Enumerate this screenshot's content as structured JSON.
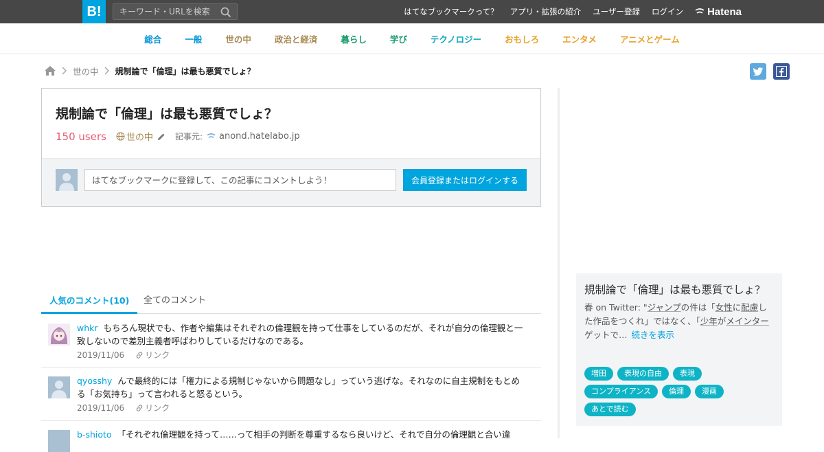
{
  "topbar": {
    "logo": "B!",
    "search_placeholder": "キーワード・URLを検索",
    "nav": [
      "はてなブックマークって？",
      "アプリ・拡張の紹介",
      "ユーザー登録",
      "ログイン"
    ],
    "brand": "Hatena"
  },
  "categories": [
    {
      "label": "総合",
      "color": "#0094d5"
    },
    {
      "label": "一般",
      "color": "#0094d5"
    },
    {
      "label": "世の中",
      "color": "#a88851"
    },
    {
      "label": "政治と経済",
      "color": "#a88851"
    },
    {
      "label": "暮らし",
      "color": "#1a9c6b"
    },
    {
      "label": "学び",
      "color": "#1a9c6b"
    },
    {
      "label": "テクノロジー",
      "color": "#14a5c4"
    },
    {
      "label": "おもしろ",
      "color": "#e8a12b"
    },
    {
      "label": "エンタメ",
      "color": "#e8a12b"
    },
    {
      "label": "アニメとゲーム",
      "color": "#e8a12b"
    }
  ],
  "breadcrumb": {
    "category": "世の中",
    "current": "規制論で「倫理」は最も悪質でしょ？"
  },
  "entry": {
    "title": "規制論で「倫理」は最も悪質でしょ？",
    "users": "150 users",
    "category": "世の中",
    "source_label": "記事元:",
    "source": "anond.hatelabo.jp",
    "comment_placeholder": "はてなブックマークに登録して、この記事にコメントしよう！",
    "login_button": "会員登録またはログインする"
  },
  "tabs": {
    "popular": "人気のコメント(10)",
    "all": "全てのコメント"
  },
  "comments": [
    {
      "user": "whkr",
      "text": "もちろん現状でも、作者や編集はそれぞれの倫理観を持って仕事をしているのだが、それが自分の倫理観と一致しないので差別主義者呼ばわりしているだけなのである。",
      "date": "2019/11/06",
      "link": "リンク"
    },
    {
      "user": "qyosshy",
      "text": "んで最終的には「権力による規制じゃないから問題なし」っていう逃げな。それなのに自主規制をもとめる「お気持ち」って言われると怒るという。",
      "date": "2019/11/06",
      "link": "リンク"
    },
    {
      "user": "b-shioto",
      "text": "「それぞれ倫理観を持って……って相手の判断を尊重するなら良いけど、それで自分の倫理観と合い違",
      "date": "",
      "link": ""
    }
  ],
  "sidebar": {
    "title": "規制論で「倫理」は最も悪質でしょ？",
    "text_prefix": "春 on Twitter: \"",
    "text_1": "ジャンプ",
    "text_2": "の件は「",
    "text_3": "女性",
    "text_4": "に",
    "text_5": "配慮",
    "text_6": "した作品をつくれ」ではなく、「",
    "text_7": "少年",
    "text_8": "が",
    "text_9": "メインター",
    "text_10": "ゲットで…",
    "more": "続きを表示",
    "tags": [
      "増田",
      "表現の自由",
      "表現",
      "コンプライアンス",
      "倫理",
      "漫画",
      "あとで読む"
    ]
  }
}
